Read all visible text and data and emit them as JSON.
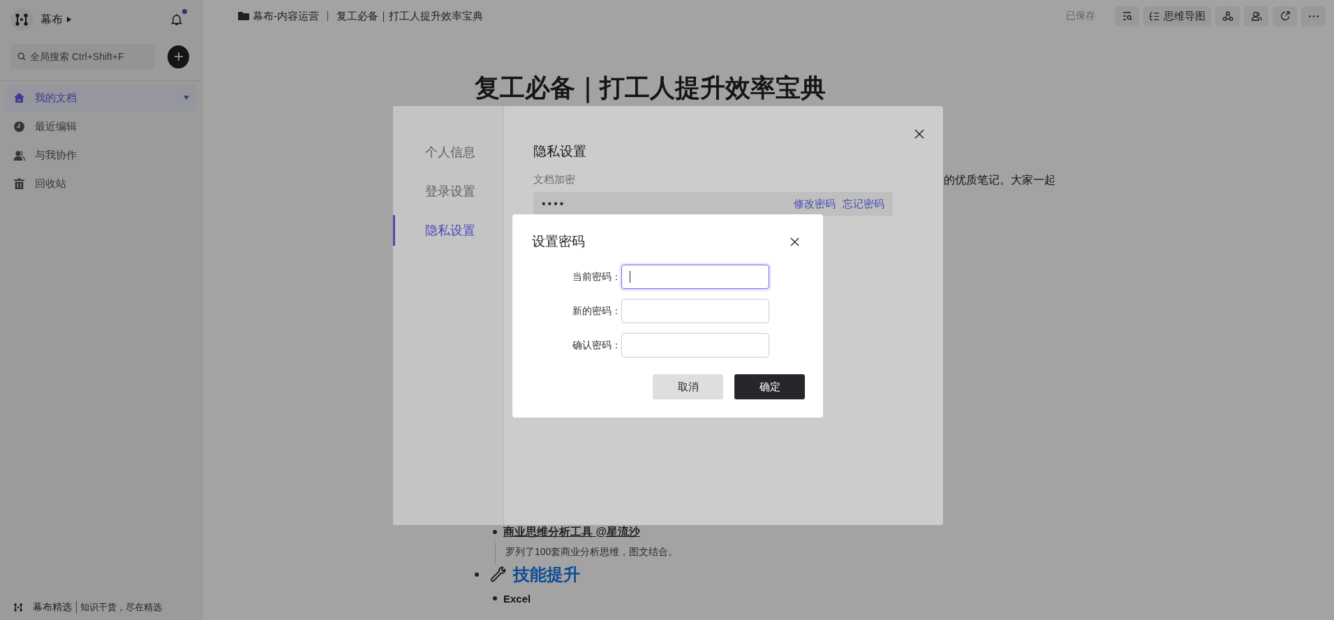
{
  "sidebar": {
    "brand": "幕布",
    "notification_unread": true,
    "search": {
      "placeholder": "全局搜索 Ctrl+Shift+F"
    },
    "items": [
      {
        "label": "我的文档",
        "selected": true,
        "expanded": true
      },
      {
        "label": "最近编辑",
        "selected": false
      },
      {
        "label": "与我协作",
        "selected": false
      },
      {
        "label": "回收站",
        "selected": false
      }
    ],
    "footer": {
      "brand": "幕布精选",
      "slogan": "知识干货，尽在精选"
    }
  },
  "topbar": {
    "breadcrumb": [
      "幕布-内容运营",
      "复工必备｜打工人提升效率宝典"
    ],
    "save_status": "已保存",
    "mindmap_button": "思维导图"
  },
  "document": {
    "title": "复工必备｜打工人提升效率宝典",
    "intro_fragment": "的优质笔记。大家一起",
    "continued": [
      {
        "kind": "link",
        "text": "商业思维分析工具 @星流沙",
        "note": "罗列了100套商业分析思维，图文结合。"
      }
    ],
    "outline": [
      {
        "kind": "heading",
        "text": "技能提升",
        "children": [
          {
            "kind": "bold",
            "text": "Excel"
          }
        ]
      }
    ]
  },
  "settings": {
    "nav": [
      {
        "label": "个人信息",
        "selected": false
      },
      {
        "label": "登录设置",
        "selected": false
      },
      {
        "label": "隐私设置",
        "selected": true
      }
    ],
    "section_title": "隐私设置",
    "field_label": "文档加密",
    "masked_value": "••••",
    "links": [
      "修改密码",
      "忘记密码"
    ]
  },
  "dialog": {
    "title": "设置密码",
    "fields": [
      {
        "label": "当前密码：",
        "focused": true
      },
      {
        "label": "新的密码：",
        "focused": false
      },
      {
        "label": "确认密码：",
        "focused": false
      }
    ],
    "cancel": "取消",
    "confirm": "确定"
  }
}
